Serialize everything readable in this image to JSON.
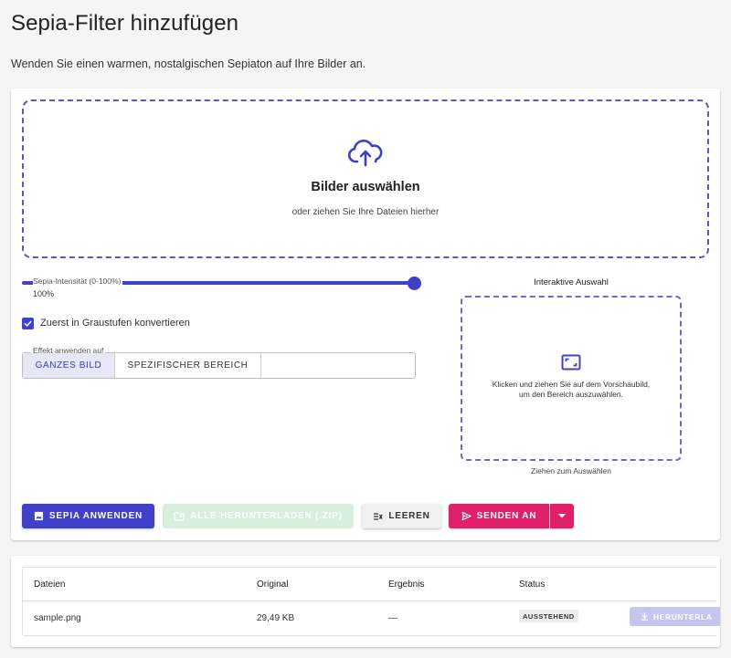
{
  "page": {
    "title": "Sepia-Filter hinzufügen",
    "subtitle": "Wenden Sie einen warmen, nostalgischen Sepiaton auf Ihre Bilder an."
  },
  "dropzone": {
    "icon": "cloud-upload-icon",
    "title": "Bilder auswählen",
    "subtitle": "oder ziehen Sie Ihre Dateien hierher"
  },
  "slider": {
    "label": "Sepia-Intensität (0-100%)",
    "value_text": "100%",
    "value": 100
  },
  "checkbox": {
    "label": "Zuerst in Graustufen konvertieren",
    "checked": true
  },
  "apply_area": {
    "legend": "Effekt anwenden auf",
    "options": [
      "GANZES BILD",
      "SPEZIFISCHER BEREICH"
    ],
    "selected": "GANZES BILD"
  },
  "selection": {
    "title": "Interaktive Auswahl",
    "icon": "select-area-icon",
    "text_line1": "Klicken und ziehen Sie auf dem Vorschaubild,",
    "text_line2": "um den Bereich auszuwählen.",
    "hint": "Ziehen zum Auswählen"
  },
  "actions": {
    "apply": "SEPIA ANWENDEN",
    "download_zip": "ALLE HERUNTERLADEN (.ZIP)",
    "clear": "LEEREN",
    "send": "SENDEN AN"
  },
  "table": {
    "headers": [
      "Dateien",
      "Original",
      "Ergebnis",
      "Status"
    ],
    "rows": [
      {
        "file": "sample.png",
        "original": "29,49 KB",
        "result": "—",
        "status": "AUSSTEHEND",
        "action": "HERUNTERLA"
      }
    ]
  },
  "colors": {
    "primary": "#4040c8",
    "accent": "#e0206a",
    "success_disabled": "#d7efdc"
  }
}
